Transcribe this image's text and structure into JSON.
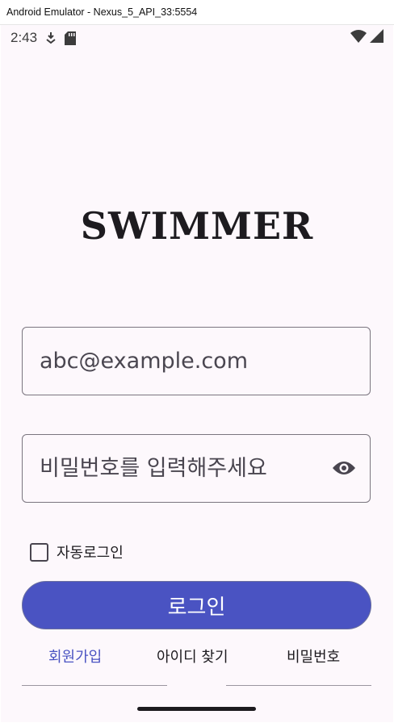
{
  "window": {
    "title": "Android Emulator - Nexus_5_API_33:5554"
  },
  "statusbar": {
    "time": "2:43",
    "icons": [
      "download-status-icon",
      "sd-card-icon",
      "wifi-icon",
      "cell-signal-icon"
    ]
  },
  "app": {
    "logo_text": "SWIMMER"
  },
  "login_form": {
    "email_placeholder": "abc@example.com",
    "password_placeholder": "비밀번호를 입력해주세요",
    "show_password_icon": "eye-icon",
    "auto_login_label": "자동로그인",
    "auto_login_checked": false,
    "login_button": "로그인"
  },
  "links": {
    "signup": "회원가입",
    "find_id": "아이디 찾기",
    "find_password": "비밀번호"
  },
  "colors": {
    "primary": "#4a53c2",
    "background": "#fdf8fc",
    "text": "#1d1b1f",
    "outline": "#7a757f"
  }
}
